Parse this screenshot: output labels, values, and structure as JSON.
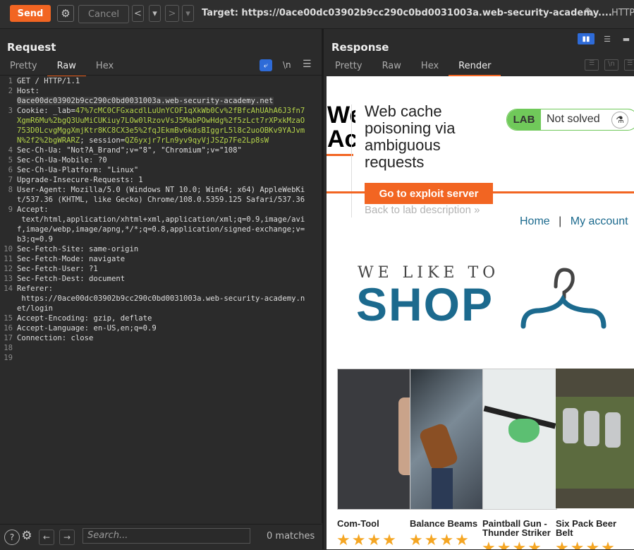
{
  "toolbar": {
    "send": "Send",
    "cancel": "Cancel",
    "back": "<",
    "back_dd": "▾",
    "forward": ">",
    "forward_dd": "▾",
    "target": "Target: https://0ace00dc03902b9cc290c0bd0031003a.web-security-academy....",
    "http_tab": "HTTP"
  },
  "request": {
    "title": "Request",
    "tabs": [
      "Pretty",
      "Raw",
      "Hex"
    ],
    "active_tab": "Raw",
    "wrap_icon": "wrap-icon",
    "newline_label": "\\n",
    "menu_icon": "menu-icon",
    "lines": [
      {
        "n": "1",
        "k": "GET / HTTP/1.1",
        "v": ""
      },
      {
        "n": "2",
        "k": "Host:",
        "v": "0ace00dc03902b9cc290c0bd0031003a.web-security-academy.net"
      },
      {
        "n": "3",
        "k": "Cookie: ",
        "v": ""
      },
      {
        "n": "4",
        "k": "Sec-Ch-Ua:",
        "v": " \"Not?A_Brand\";v=\"8\", \"Chromium\";v=\"108\""
      },
      {
        "n": "5",
        "k": "Sec-Ch-Ua-Mobile:",
        "v": " ?0"
      },
      {
        "n": "6",
        "k": "Sec-Ch-Ua-Platform:",
        "v": " \"Linux\""
      },
      {
        "n": "7",
        "k": "Upgrade-Insecure-Requests:",
        "v": " 1"
      },
      {
        "n": "8",
        "k": "User-Agent:",
        "v": " Mozilla/5.0 (Windows NT 10.0; Win64; x64) AppleWebKit/537.36 (KHTML, like Gecko) Chrome/108.0.5359.125 Safari/537.36"
      },
      {
        "n": "9",
        "k": "Accept:",
        "v": " text/html,application/xhtml+xml,application/xml;q=0.9,image/avif,image/webp,image/apng,*/*;q=0.8,application/signed-exchange;v=b3;q=0.9"
      },
      {
        "n": "10",
        "k": "Sec-Fetch-Site:",
        "v": " same-origin"
      },
      {
        "n": "11",
        "k": "Sec-Fetch-Mode:",
        "v": " navigate"
      },
      {
        "n": "12",
        "k": "Sec-Fetch-User:",
        "v": " ?1"
      },
      {
        "n": "13",
        "k": "Sec-Fetch-Dest:",
        "v": " document"
      },
      {
        "n": "14",
        "k": "Referer:",
        "v": " https://0ace00dc03902b9cc290c0bd0031003a.web-security-academy.net/login"
      },
      {
        "n": "15",
        "k": "Accept-Encoding:",
        "v": " gzip, deflate"
      },
      {
        "n": "16",
        "k": "Accept-Language:",
        "v": " en-US,en;q=0.9"
      },
      {
        "n": "17",
        "k": "Connection:",
        "v": " close"
      },
      {
        "n": "18",
        "k": "",
        "v": ""
      },
      {
        "n": "19",
        "k": "",
        "v": ""
      }
    ],
    "cookie_lab_key": "_lab=",
    "cookie_lab_val": "47%7cMC0CFGxacdlLuUnYCOF1qXkWb0Cv%2fBfcAhUAhA6J3fn7XgmR6Mu%2bgQ3UuMiCUKiuy7LOw0lRzovVsJ5MabPOwHdg%2f5zLct7rXPxkMzaO753D0LcvgMggXmjKtr8KC8CX3e5%2fqJEkmBv6kdsBIggrL5l8c2uoOBKv9YAJvmN%2f2%2bgWRARZ",
    "cookie_sep": "; ",
    "cookie_session_key": "session=",
    "cookie_session_val": "QZ6yxjr7rLn9yv9qyVjJSZp7Fe2Lp8sW"
  },
  "bottom": {
    "search_placeholder": "Search...",
    "matches": "0 matches"
  },
  "response": {
    "title": "Response",
    "tabs": [
      "Pretty",
      "Raw",
      "Hex",
      "Render"
    ],
    "active_tab": "Render",
    "newline_label": "\\n"
  },
  "page": {
    "logo_partial": "We\nAc",
    "lab_title": "Web cache poisoning via ambiguous requests",
    "lab_badge": "LAB",
    "lab_status": "Not solved",
    "exploit_button": "Go to exploit server",
    "back_link": "Back to lab description",
    "nav_home": "Home",
    "nav_sep": "|",
    "nav_account": "My account",
    "hero_top": "WE LIKE TO",
    "hero_main": "SHOP",
    "products": [
      "Com-Tool",
      "Balance Beams",
      "Paintball Gun - Thunder Striker",
      "Six Pack Beer Belt"
    ],
    "colors": {
      "accent": "#f26522",
      "lab_green": "#70c95a",
      "shop_blue": "#1c6a8e"
    }
  }
}
